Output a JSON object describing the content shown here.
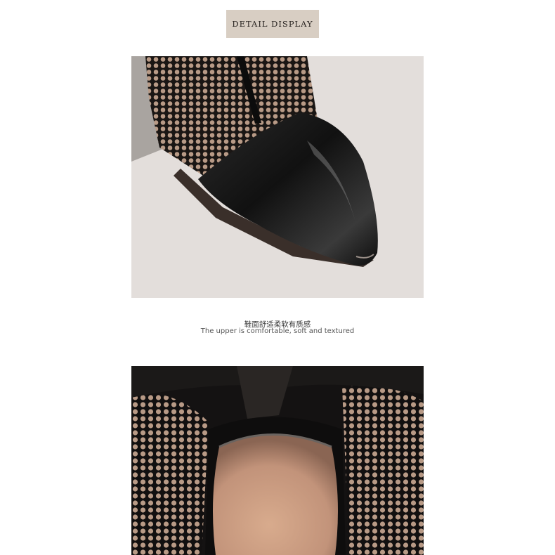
{
  "banner": {
    "title": "DETAIL DISPLAY"
  },
  "caption": {
    "chinese": "鞋面舒适柔软有质感",
    "english": "The upper is comfortable, soft and textured"
  },
  "photos": [
    {
      "name": "shoe-toe-closeup",
      "subject": "black pointed leather toe cap with mesh upper"
    },
    {
      "name": "shoe-opening-closeup",
      "subject": "black mesh shoe opening with beige insole"
    }
  ],
  "colors": {
    "banner_bg": "#d8cec3",
    "photo_bg": "#e3dedb",
    "leather": "#141414",
    "insole": "#c99a7c",
    "mesh_skin": "#b89a86"
  }
}
